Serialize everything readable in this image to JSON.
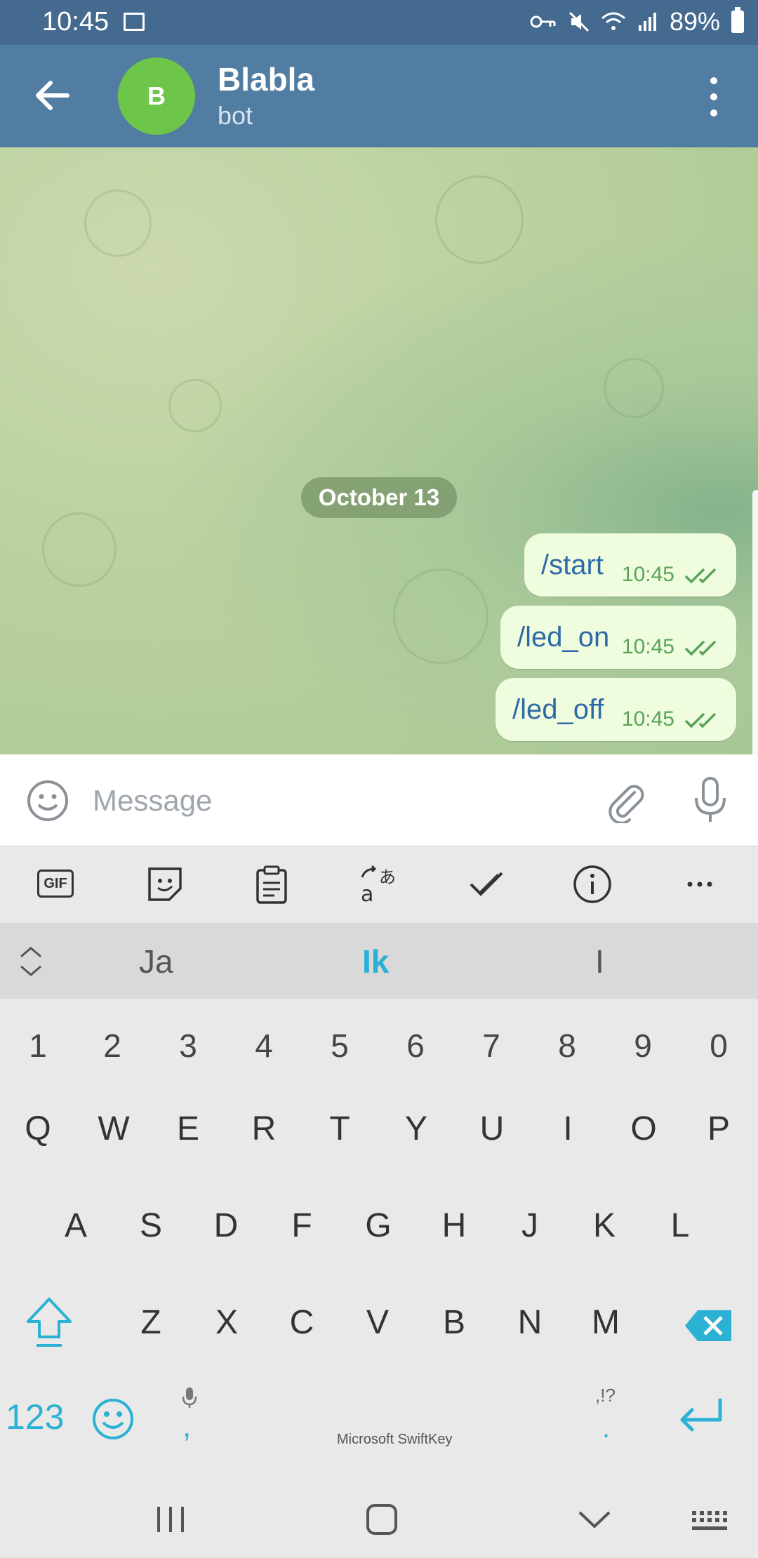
{
  "status": {
    "time": "10:45",
    "battery": "89%"
  },
  "header": {
    "avatar_letter": "B",
    "title": "Blabla",
    "subtitle": "bot"
  },
  "chat": {
    "date_label": "October 13",
    "messages": [
      {
        "text": "/start",
        "time": "10:45"
      },
      {
        "text": "/led_on",
        "time": "10:45"
      },
      {
        "text": "/led_off",
        "time": "10:45"
      }
    ]
  },
  "input": {
    "placeholder": "Message"
  },
  "keyboard": {
    "toolbar_icons": [
      "gif-icon",
      "sticker-icon",
      "clipboard-icon",
      "translate-icon",
      "checkmark-icon",
      "info-icon",
      "more-icon"
    ],
    "gif_label": "GIF",
    "suggestions": [
      "Ja",
      "Ik",
      "I"
    ],
    "number_row": [
      "1",
      "2",
      "3",
      "4",
      "5",
      "6",
      "7",
      "8",
      "9",
      "0"
    ],
    "row1": [
      "Q",
      "W",
      "E",
      "R",
      "T",
      "Y",
      "U",
      "I",
      "O",
      "P"
    ],
    "row2": [
      "A",
      "S",
      "D",
      "F",
      "G",
      "H",
      "J",
      "K",
      "L"
    ],
    "row3": [
      "Z",
      "X",
      "C",
      "V",
      "B",
      "N",
      "M"
    ],
    "mode_key": "123",
    "comma_key": ",",
    "period_key": ".",
    "punct_hint": ",!?",
    "brand": "Microsoft SwiftKey",
    "accent": "#2ab1d3"
  }
}
